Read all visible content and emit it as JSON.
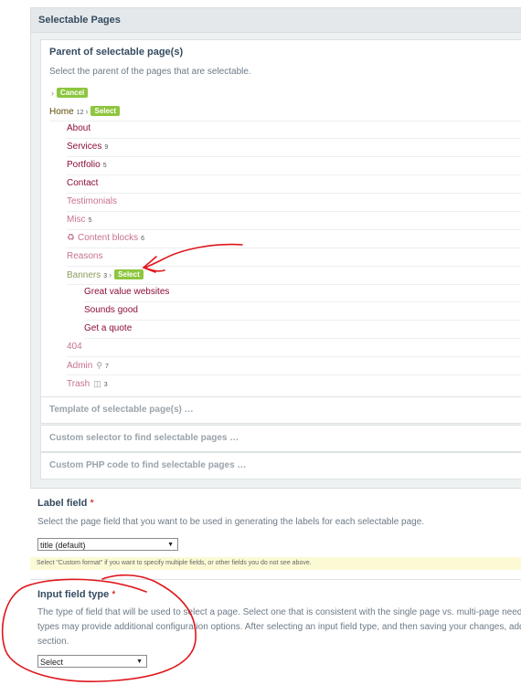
{
  "panel": {
    "title": "Selectable Pages"
  },
  "parent_section": {
    "title": "Parent of selectable page(s)",
    "description": "Select the parent of the pages that are selectable.",
    "cancel_label": "Cancel",
    "home": {
      "label": "Home",
      "count": "12",
      "select_label": "Select"
    },
    "pages": [
      {
        "label": "About"
      },
      {
        "label": "Services",
        "count": "9"
      },
      {
        "label": "Portfolio",
        "count": "5"
      },
      {
        "label": "Contact"
      },
      {
        "label": "Testimonials"
      },
      {
        "label": "Misc",
        "count": "5"
      },
      {
        "label": "Content blocks",
        "count": "6"
      },
      {
        "label": "Reasons"
      },
      {
        "label": "Banners",
        "count": "3",
        "select_label": "Select"
      },
      {
        "label": "Great value websites"
      },
      {
        "label": "Sounds good"
      },
      {
        "label": "Get a quote"
      },
      {
        "label": "404"
      },
      {
        "label": "Admin",
        "count": "7"
      },
      {
        "label": "Trash",
        "count": "3"
      }
    ]
  },
  "collapsed_sections": [
    {
      "label": "Template of selectable page(s) …"
    },
    {
      "label": "Custom selector to find selectable pages …"
    },
    {
      "label": "Custom PHP code to find selectable pages …"
    }
  ],
  "label_field": {
    "title": "Label field",
    "required_mark": "*",
    "description": "Select the page field that you want to be used in generating the labels for each selectable page.",
    "selected": "title (default)",
    "note": "Select \"Custom format\" if you want to specify multiple fields, or other fields you do not see above."
  },
  "input_field_type": {
    "title": "Input field type",
    "required_mark": "*",
    "description_lines": [
      "The type of field that will be used to select a page. Select one that is consistent with the single page vs. multi-page needs you c",
      "types may provide additional configuration options. After selecting an input field type, and then saving your changes, additional",
      "section."
    ],
    "selected": "Select"
  },
  "colors": {
    "accent_green": "#8dc63f",
    "link": "#8d0e3a",
    "annotation_red": "#e0161b"
  }
}
